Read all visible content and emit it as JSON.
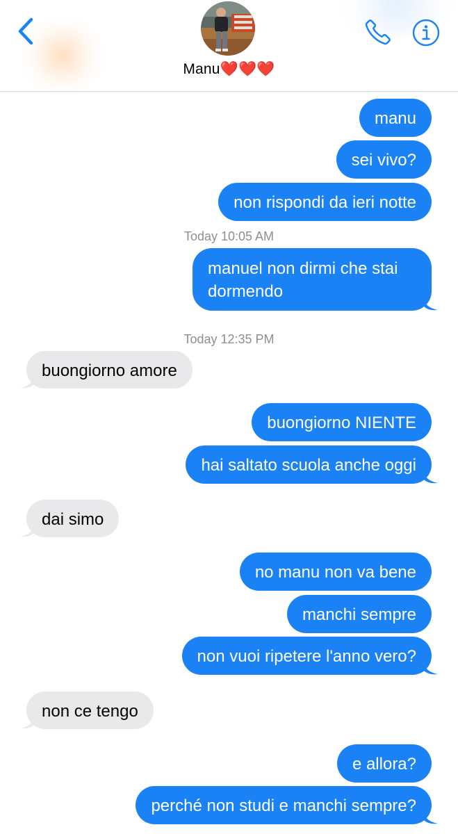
{
  "header": {
    "contact_name": "Manu❤️❤️❤️",
    "back_icon": "chevron-left-icon",
    "call_icon": "phone-icon",
    "info_icon": "info-icon",
    "accent_color": "#1b82f6"
  },
  "conversation": {
    "messages": [
      {
        "text": "manu",
        "sender": "me"
      },
      {
        "text": "sei vivo?",
        "sender": "me"
      },
      {
        "text": "non rispondi da ieri notte",
        "sender": "me"
      },
      {
        "text": "manuel non dirmi che stai dormendo",
        "sender": "me"
      },
      {
        "text": "buongiorno amore",
        "sender": "contact"
      },
      {
        "text": "buongiorno NIENTE",
        "sender": "me"
      },
      {
        "text": "hai saltato scuola anche oggi",
        "sender": "me"
      },
      {
        "text": "dai simo",
        "sender": "contact"
      },
      {
        "text": "no manu non va bene",
        "sender": "me"
      },
      {
        "text": "manchi sempre",
        "sender": "me"
      },
      {
        "text": "non vuoi ripetere l'anno vero?",
        "sender": "me"
      },
      {
        "text": "non ce tengo",
        "sender": "contact"
      },
      {
        "text": "e allora?",
        "sender": "me"
      },
      {
        "text": "perché non studi e manchi sempre?",
        "sender": "me"
      }
    ],
    "timestamps": [
      "Today 10:05 AM",
      "Today 12:35 PM"
    ]
  },
  "colors": {
    "outgoing_bubble": "#1b82f6",
    "incoming_bubble": "#e9e9eb",
    "timestamp_text": "#8e8e93"
  }
}
